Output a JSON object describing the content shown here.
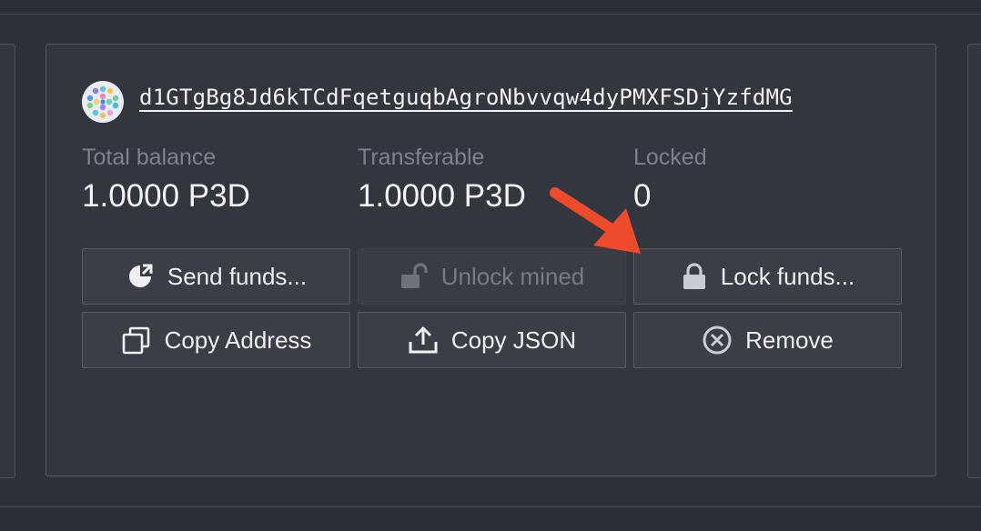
{
  "account": {
    "address": "d1GTgBg8Jd6kTCdFqetguqbAgroNbvvqw4dyPMXFSDjYzfdMG",
    "stats": {
      "total_label": "Total balance",
      "total_value": "1.0000 P3D",
      "transferable_label": "Transferable",
      "transferable_value": "1.0000 P3D",
      "locked_label": "Locked",
      "locked_value": "0"
    },
    "actions": {
      "send": "Send funds...",
      "unlock": "Unlock mined",
      "lock": "Lock funds...",
      "copy_address": "Copy Address",
      "copy_json": "Copy JSON",
      "remove": "Remove"
    },
    "states": {
      "unlock_disabled": true
    }
  },
  "colors": {
    "background": "#2e3138",
    "card": "#33363e",
    "button": "#3b3e46",
    "text": "#eef0f2",
    "muted_label": "#7d828c",
    "annotation_arrow": "#ee4a2c"
  },
  "icons": {
    "identicon": "identicon-avatar",
    "send": "send-icon",
    "unlock": "unlock-icon",
    "lock": "lock-icon",
    "copy_address": "copy-icon",
    "copy_json": "upload-icon",
    "remove": "close-circle-icon",
    "annotation": "annotation-arrow"
  }
}
